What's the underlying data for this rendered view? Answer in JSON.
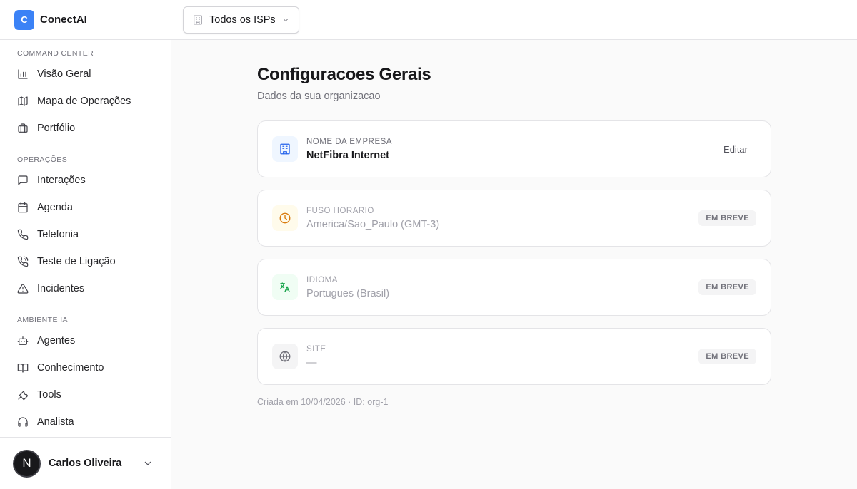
{
  "brand": {
    "logo_letter": "C",
    "name": "ConectAI"
  },
  "sidebar": {
    "sections": [
      {
        "title": "COMMAND CENTER",
        "items": [
          {
            "label": "Visão Geral",
            "icon": "bar-chart-icon"
          },
          {
            "label": "Mapa de Operações",
            "icon": "map-icon"
          },
          {
            "label": "Portfólio",
            "icon": "briefcase-icon"
          }
        ]
      },
      {
        "title": "OPERAÇÕES",
        "items": [
          {
            "label": "Interações",
            "icon": "message-square-icon"
          },
          {
            "label": "Agenda",
            "icon": "calendar-icon"
          },
          {
            "label": "Telefonia",
            "icon": "phone-icon"
          },
          {
            "label": "Teste de Ligação",
            "icon": "phone-call-icon"
          },
          {
            "label": "Incidentes",
            "icon": "alert-triangle-icon"
          }
        ]
      },
      {
        "title": "AMBIENTE IA",
        "items": [
          {
            "label": "Agentes",
            "icon": "bot-icon"
          },
          {
            "label": "Conhecimento",
            "icon": "book-open-icon"
          },
          {
            "label": "Tools",
            "icon": "wrench-icon"
          },
          {
            "label": "Analista",
            "icon": "headphones-icon"
          }
        ]
      }
    ]
  },
  "user": {
    "avatar_letter": "N",
    "name": "Carlos Oliveira"
  },
  "topbar": {
    "isp_select_value": "Todos os ISPs"
  },
  "page": {
    "title": "Configuracoes Gerais",
    "subtitle": "Dados da sua organizacao"
  },
  "settings": [
    {
      "label": "NOME DA EMPRESA",
      "value": "NetFibra Internet",
      "action": "Editar",
      "icon": "building-icon",
      "accent": "#2563eb"
    },
    {
      "label": "FUSO HORARIO",
      "value": "America/Sao_Paulo (GMT-3)",
      "badge": "EM BREVE",
      "icon": "clock-icon",
      "accent": "#d97706"
    },
    {
      "label": "IDIOMA",
      "value": "Portugues (Brasil)",
      "badge": "EM BREVE",
      "icon": "languages-icon",
      "accent": "#16a34a"
    },
    {
      "label": "SITE",
      "value": "—",
      "badge": "EM BREVE",
      "icon": "globe-icon",
      "accent": "#71717a"
    }
  ],
  "footer_meta": "Criada em 10/04/2026 · ID: org-1"
}
